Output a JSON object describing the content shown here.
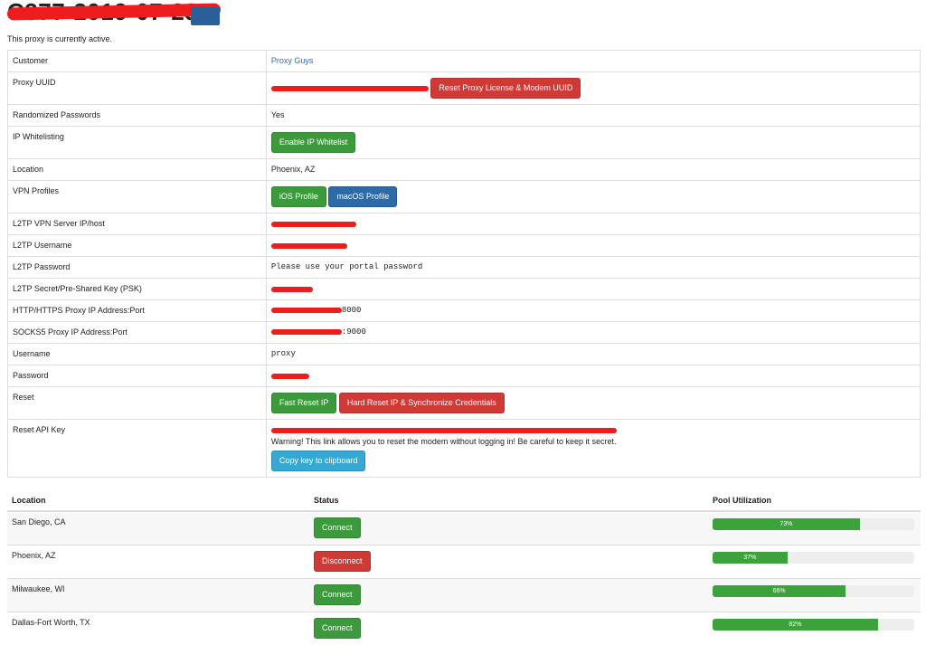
{
  "header": {
    "title": "C377-2019-07-23",
    "status_text": "This proxy is currently active."
  },
  "details": {
    "customer": {
      "label": "Customer",
      "value": "Proxy Guys"
    },
    "uuid": {
      "label": "Proxy UUID",
      "button": "Reset Proxy License & Modem UUID"
    },
    "randomized": {
      "label": "Randomized Passwords",
      "value": "Yes"
    },
    "whitelist": {
      "label": "IP Whitelisting",
      "button": "Enable IP Whitelist"
    },
    "location": {
      "label": "Location",
      "value": "Phoenix, AZ"
    },
    "vpn": {
      "label": "VPN Profiles",
      "ios_button": "iOS Profile",
      "macos_button": "macOS Profile"
    },
    "l2tp_server": {
      "label": "L2TP VPN Server IP/host"
    },
    "l2tp_user": {
      "label": "L2TP Username"
    },
    "l2tp_pass": {
      "label": "L2TP Password",
      "value": "Please use your portal password"
    },
    "l2tp_psk": {
      "label": "L2TP Secret/Pre-Shared Key (PSK)"
    },
    "http_proxy": {
      "label": "HTTP/HTTPS Proxy IP Address:Port",
      "port": "8000"
    },
    "socks_proxy": {
      "label": "SOCKS5 Proxy IP Address:Port",
      "port": ":9000"
    },
    "username": {
      "label": "Username",
      "value": "proxy"
    },
    "password": {
      "label": "Password"
    },
    "reset": {
      "label": "Reset",
      "fast_button": "Fast Reset IP",
      "hard_button": "Hard Reset IP & Synchronize Credentials"
    },
    "reset_api": {
      "label": "Reset API Key",
      "warning": "Warning! This link allows you to reset the modem without logging in! Be careful to keep it secret.",
      "copy_button": "Copy key to clipboard"
    }
  },
  "locations": {
    "headers": {
      "location": "Location",
      "status": "Status",
      "pool": "Pool Utilization"
    },
    "rows": [
      {
        "name": "San Diego, CA",
        "action": "Connect",
        "action_type": "success",
        "utilization": 73,
        "util_label": "73%"
      },
      {
        "name": "Phoenix, AZ",
        "action": "Disconnect",
        "action_type": "danger",
        "utilization": 37,
        "util_label": "37%"
      },
      {
        "name": "Milwaukee, WI",
        "action": "Connect",
        "action_type": "success",
        "utilization": 66,
        "util_label": "66%"
      },
      {
        "name": "Dallas-Fort Worth, TX",
        "action": "Connect",
        "action_type": "success",
        "utilization": 82,
        "util_label": "82%"
      }
    ]
  },
  "colors": {
    "success": "#3c9a3c",
    "danger": "#cf3a36",
    "primary": "#2d6aa6",
    "info": "#37a8d3",
    "redaction": "#ee1c1c"
  }
}
